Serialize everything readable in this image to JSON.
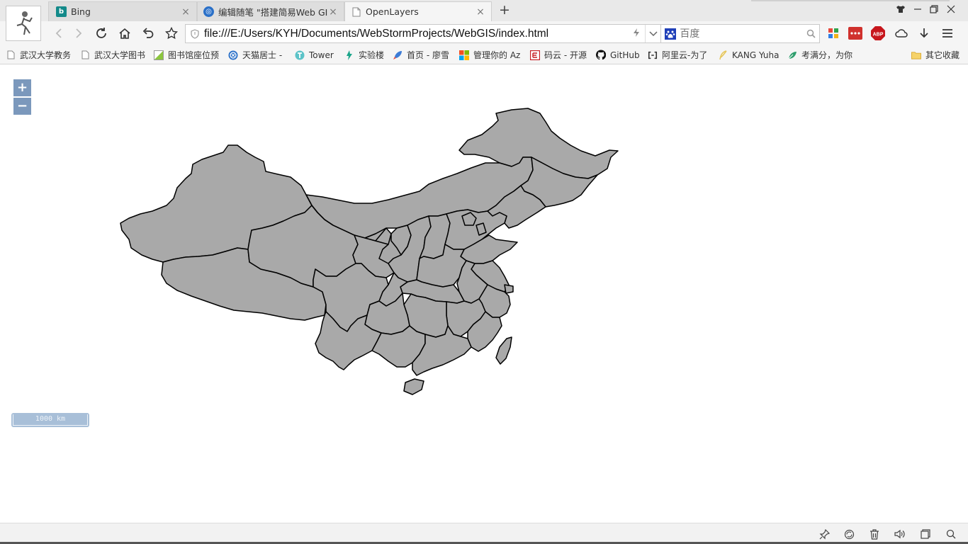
{
  "browser": {
    "tabs": [
      {
        "title": "Bing",
        "icon": "bing-icon"
      },
      {
        "title": "编辑随笔 \"搭建简易Web GIS",
        "icon": "cnblogs-icon"
      },
      {
        "title": "OpenLayers",
        "icon": "page-icon"
      }
    ],
    "address": "file:///E:/Users/KYH/Documents/WebStormProjects/WebGIS/index.html",
    "search_placeholder": "百度",
    "extensions": [
      "apps-grid-icon",
      "more-dots-icon",
      "adblock-icon",
      "cloud-icon",
      "download-icon",
      "menu-icon"
    ],
    "abp_label": "ABP"
  },
  "bookmarks": [
    {
      "label": "武汉大学教务",
      "icon": "page-icon"
    },
    {
      "label": "武汉大学图书",
      "icon": "page-icon"
    },
    {
      "label": "图书馆座位预",
      "icon": "leaf-icon"
    },
    {
      "label": "天猫居士 -",
      "icon": "globe-icon"
    },
    {
      "label": "Tower",
      "icon": "tower-icon"
    },
    {
      "label": "实验楼",
      "icon": "shiyanlou-icon"
    },
    {
      "label": "首页 - 廖雪",
      "icon": "rocket-icon"
    },
    {
      "label": "管理你的 Az",
      "icon": "microsoft-icon"
    },
    {
      "label": "码云 - 开源",
      "icon": "gitee-icon"
    },
    {
      "label": "GitHub",
      "icon": "github-icon"
    },
    {
      "label": "阿里云-为了",
      "icon": "aliyun-icon"
    },
    {
      "label": "KANG Yuha",
      "icon": "feather-icon"
    },
    {
      "label": "考满分，为你",
      "icon": "kmf-icon"
    },
    {
      "label": "其它收藏",
      "icon": "folder-icon"
    }
  ],
  "map": {
    "zoom_in_label": "+",
    "zoom_out_label": "−",
    "scale_label": "1000 km",
    "fill_color": "#a9a9a9",
    "stroke_color": "#000000"
  },
  "statusbar": {
    "icons": [
      "pin-icon",
      "refresh-icon",
      "trash-icon",
      "volume-icon",
      "window-icon",
      "search-icon"
    ]
  }
}
